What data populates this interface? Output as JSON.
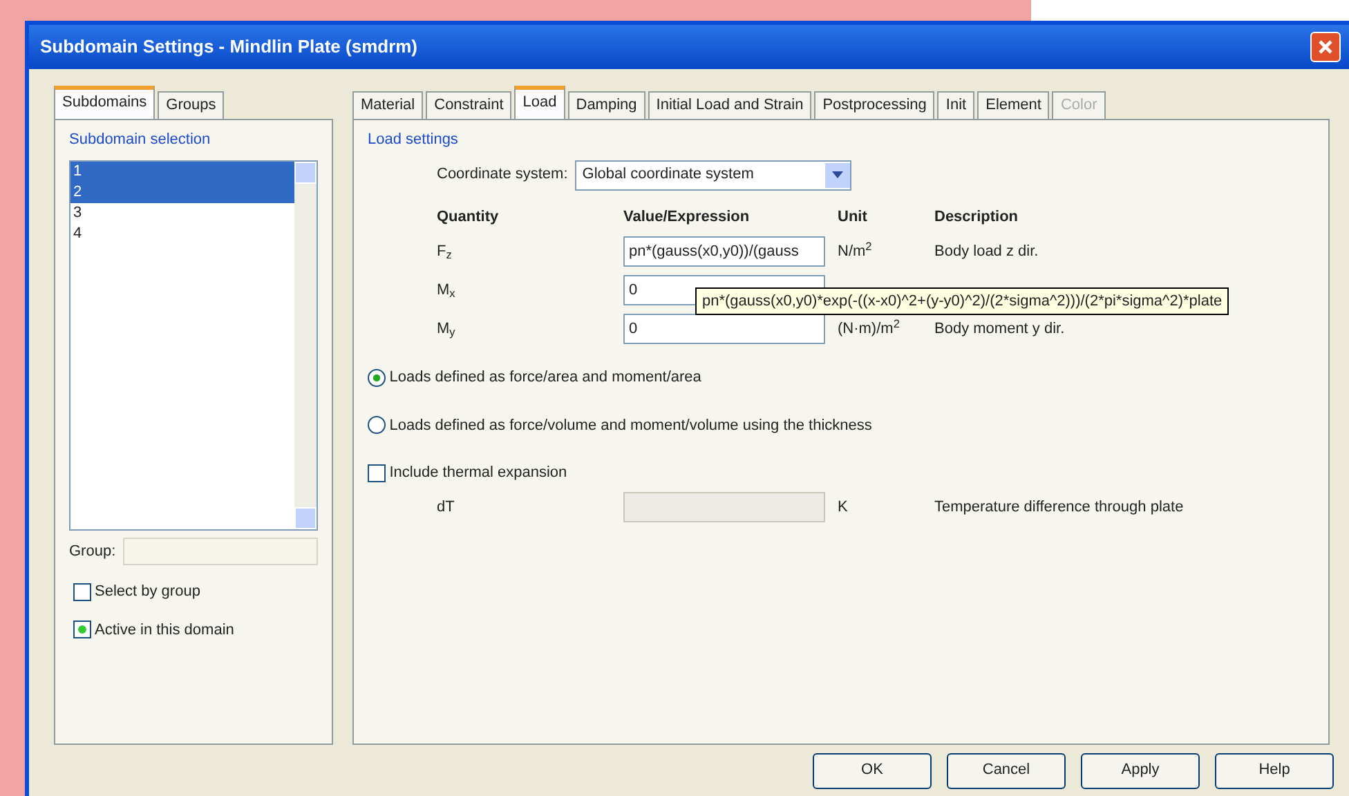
{
  "window": {
    "title": "Subdomain Settings - Mindlin Plate (smdrm)"
  },
  "left_tabs": [
    {
      "label": "Subdomains",
      "selected": true
    },
    {
      "label": "Groups",
      "selected": false
    }
  ],
  "subdomain_selection": {
    "title": "Subdomain selection",
    "items": [
      {
        "label": "1",
        "selected": true
      },
      {
        "label": "2",
        "selected": true
      },
      {
        "label": "3",
        "selected": false
      },
      {
        "label": "4",
        "selected": false
      }
    ]
  },
  "group": {
    "label": "Group:",
    "disabled": true
  },
  "options": [
    {
      "label": "Select by group",
      "checked": false
    },
    {
      "label": "Active in this domain",
      "checked": true
    }
  ],
  "tabs": [
    {
      "label": "Material",
      "selected": false,
      "disabled": false
    },
    {
      "label": "Constraint",
      "selected": false,
      "disabled": false
    },
    {
      "label": "Load",
      "selected": true,
      "disabled": false
    },
    {
      "label": "Damping",
      "selected": false,
      "disabled": false
    },
    {
      "label": "Initial Load and Strain",
      "selected": false,
      "disabled": false
    },
    {
      "label": "Postprocessing",
      "selected": false,
      "disabled": false
    },
    {
      "label": "Init",
      "selected": false,
      "disabled": false
    },
    {
      "label": "Element",
      "selected": false,
      "disabled": false
    },
    {
      "label": "Color",
      "selected": false,
      "disabled": true
    }
  ],
  "load_settings": {
    "title": "Load settings",
    "coordinate_label": "Coordinate system:",
    "coordinate_value": "Global coordinate system",
    "columns": [
      "Quantity",
      "Value/Expression",
      "Unit",
      "Description"
    ],
    "rows": [
      {
        "quantity": "F$_{z}$",
        "value": "pn*(gauss(x0,y0))/(gauss",
        "unit": "N/m$^{2}$",
        "description": "Body load z dir."
      },
      {
        "quantity": "M$_{x}$",
        "value": "0"
      },
      {
        "quantity": "M$_{y}$",
        "value": "0",
        "unit": "(N·m)/m$^{2}$",
        "description": "Body moment y dir."
      }
    ],
    "tooltip": "pn*(gauss(x0,y0)*exp(-((x-x0)^2+(y-y0)^2)/(2*sigma^2)))/(2*pi*sigma^2)*plate"
  },
  "load_definition": [
    {
      "label": "Loads defined as force/area and moment/area",
      "selected": true
    },
    {
      "label": "Loads defined as force/volume and moment/volume using the thickness",
      "selected": false
    }
  ],
  "thermal": {
    "label": "Include thermal expansion",
    "checked": false,
    "quantity": "dT",
    "unit": "K",
    "description": "Temperature difference through plate",
    "disabled": true
  },
  "buttons": [
    "OK",
    "Cancel",
    "Apply",
    "Help"
  ]
}
